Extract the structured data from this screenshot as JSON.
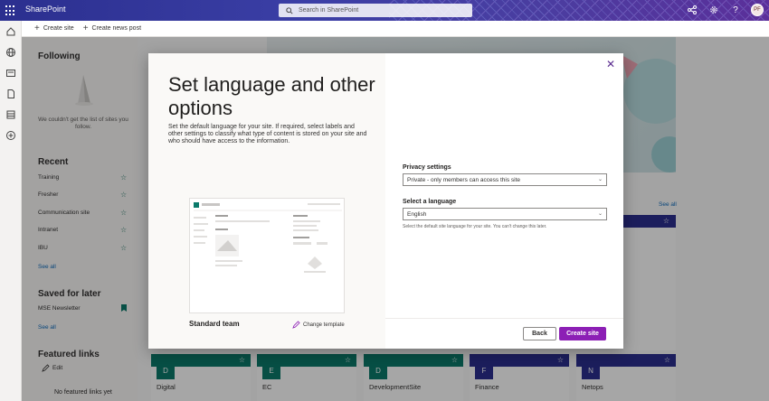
{
  "suitebar": {
    "brand": "SharePoint",
    "search_placeholder": "Search in SharePoint",
    "avatar_initials": "PF"
  },
  "commands": {
    "create_site": "Create site",
    "create_news": "Create news post"
  },
  "following": {
    "title": "Following",
    "empty": "We couldn't get the list of sites you follow."
  },
  "recent": {
    "title": "Recent",
    "items": [
      "Training",
      "Fresher",
      "Communication site",
      "Intranet",
      "IBU"
    ],
    "see_all": "See all"
  },
  "saved": {
    "title": "Saved for later",
    "item": "MSE Newsletter",
    "see_all": "See all"
  },
  "featured": {
    "title": "Featured links",
    "edit": "Edit",
    "empty": "No featured links yet"
  },
  "main": {
    "see_all": "See all"
  },
  "cards": [
    {
      "letter": "D",
      "name": "Digital"
    },
    {
      "letter": "E",
      "name": "EC"
    },
    {
      "letter": "D",
      "name": "DevelopmentSite"
    },
    {
      "letter": "F",
      "name": "Finance"
    },
    {
      "letter": "N",
      "name": "Netops"
    }
  ],
  "dialog": {
    "title": "Set language and other options",
    "description": "Set the default language for your site. If required, select labels and other settings to classify what type of content is stored on your site and who should have access to the information.",
    "template_name": "Standard team",
    "change_template": "Change template",
    "privacy_label": "Privacy settings",
    "privacy_value": "Private - only members can access this site",
    "language_label": "Select a language",
    "language_value": "English",
    "language_hint": "Select the default site language for your site. You can't change this later.",
    "back": "Back",
    "create": "Create site"
  },
  "colors": {
    "accent": "#8c1fb5",
    "suitebar": "#2b2f8f",
    "teal": "#0b7a6a"
  }
}
